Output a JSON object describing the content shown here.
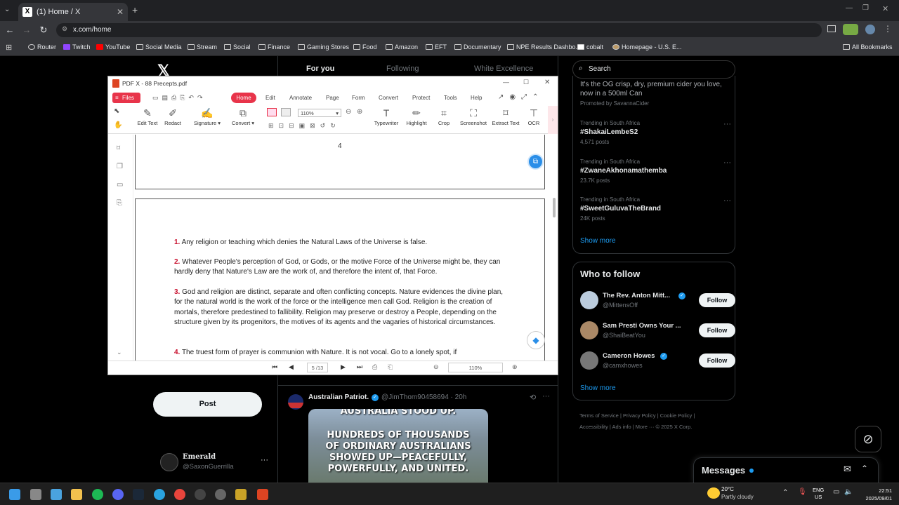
{
  "browser": {
    "tab_title": "(1) Home / X",
    "new_tab": "+",
    "url": "x.com/home",
    "bookmarks": [
      "Router",
      "Twitch",
      "YouTube",
      "Social Media",
      "Stream",
      "Social",
      "Finance",
      "Gaming Stores",
      "Food",
      "Amazon",
      "EFT",
      "Documentary",
      "NPE Results Dashbo...",
      "cobalt",
      "Homepage - U.S. E..."
    ],
    "all_bookmarks": "All Bookmarks"
  },
  "x": {
    "tabs": [
      "For you",
      "Following",
      "White Excellence"
    ],
    "search_placeholder": "Search",
    "promo_text1": "It's the OG crisp, dry, premium cider you love,",
    "promo_text2": "now in a 500ml Can",
    "promoted_by": "Promoted by SavannaCider",
    "trends": [
      {
        "context": "Trending in South Africa",
        "tag": "#ShakaiLembeS2",
        "posts": "4,571 posts"
      },
      {
        "context": "Trending in South Africa",
        "tag": "#ZwaneAkhonamathemba",
        "posts": "23.7K posts"
      },
      {
        "context": "Trending in South Africa",
        "tag": "#SweetGuluvaTheBrand",
        "posts": "24K posts"
      }
    ],
    "show_more": "Show more",
    "who_to_follow": "Who to follow",
    "follow_suggestions": [
      {
        "name": "The Rev. Anton Mitt...",
        "handle": "@MittensOff",
        "button": "Follow"
      },
      {
        "name": "Sam Presti Owns Your ...",
        "handle": "@ShaiBeatYou",
        "button": "Follow"
      },
      {
        "name": "Cameron Howes",
        "handle": "@camxhowes",
        "button": "Follow"
      }
    ],
    "show_more2": "Show more",
    "footer": [
      "Terms of Service",
      "Privacy Policy",
      "Cookie Policy",
      "Accessibility",
      "Ads info",
      "More ···",
      "© 2025 X Corp."
    ],
    "post_button": "Post",
    "account_name": "Emerald",
    "account_handle": "@SaxonGuerrilla",
    "tweet_author": "Australian Patriot.",
    "tweet_handle": "@JimThom90458694 · 20h",
    "tweet_image_text": [
      "AUSTRALIA STOOD UP.",
      "HUNDREDS OF THOUSANDS",
      "OF ORDINARY AUSTRALIANS",
      "SHOWED UP—PEACEFULLY,",
      "POWERFULLY, AND UNITED."
    ],
    "messages": "Messages"
  },
  "pdf": {
    "title": "PDF X - 88 Precepts.pdf",
    "files_btn": "Files",
    "menu": [
      "Home",
      "Edit",
      "Annotate",
      "Page",
      "Form",
      "Convert",
      "Protect",
      "Tools",
      "Help"
    ],
    "tools": [
      "Edit Text",
      "Redact",
      "Signature ▾",
      "Convert ▾",
      "Typewriter",
      "Highlight",
      "Crop",
      "Screenshot",
      "Extract Text",
      "OCR"
    ],
    "zoom": "110%",
    "page_number_prev": "4",
    "precepts": [
      {
        "num": "1.",
        "text": "Any religion or teaching which denies the Natural Laws of the Universe is false."
      },
      {
        "num": "2.",
        "text": "Whatever People's perception of God, or Gods, or the motive Force of the Universe might be, they can hardly deny that Nature's Law are the work of, and therefore the intent of, that Force."
      },
      {
        "num": "3.",
        "text": "God and religion are distinct, separate and often conflicting concepts. Nature evidences the divine plan, for the natural world is the work of the force or the intelligence men call God. Religion is the creation of mortals, therefore predestined to fallibility. Religion may preserve or destroy a People, depending on the structure given by its progenitors, the motives of its agents and the vagaries of historical circumstances."
      },
      {
        "num": "4.",
        "text": "The truest form of prayer is communion with Nature. It is not vocal. Go to a lonely spot, if"
      }
    ],
    "page_indicator": "5 /13",
    "zoom_bottom": "110%"
  },
  "taskbar": {
    "weather_temp": "20°C",
    "weather_desc": "Partly cloudy",
    "lang1": "ENG",
    "lang2": "US",
    "time": "22:51",
    "date": "2025/09/01"
  }
}
